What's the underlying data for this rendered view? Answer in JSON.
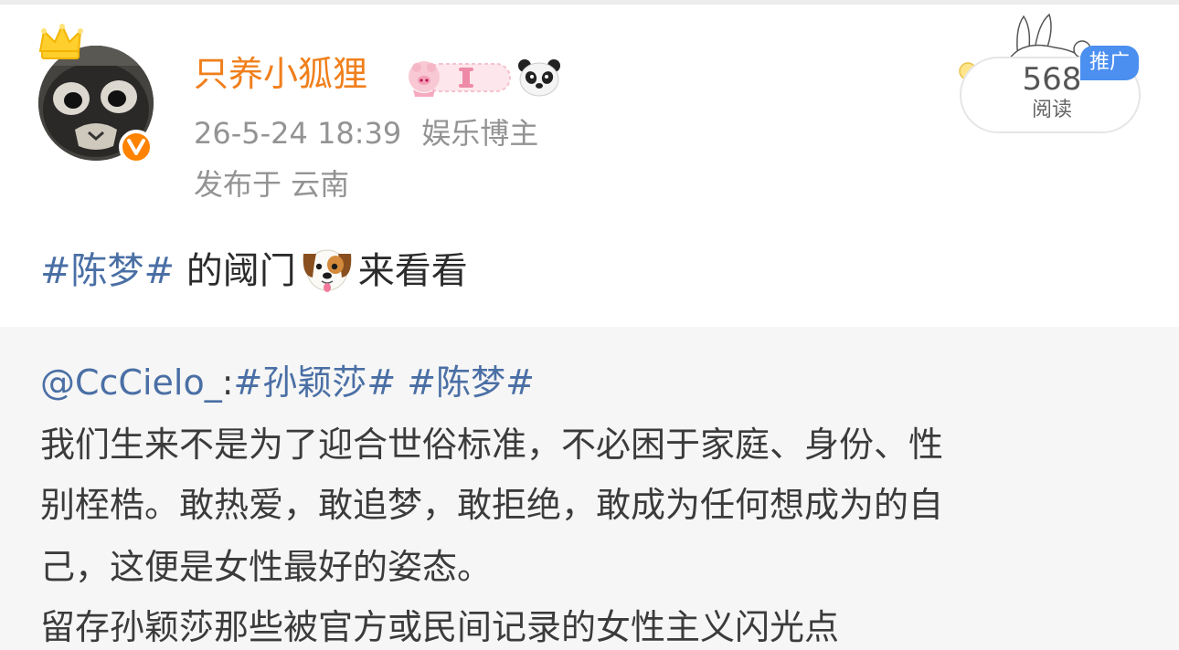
{
  "post": {
    "author": {
      "name": "只养小狐狸",
      "avatar_icon": "avatar-image",
      "verified_icon": "verified-v-icon",
      "crown_icon": "crown-icon",
      "badge_icon": "pig-bow-badge-icon",
      "panda_icon": "panda-icon"
    },
    "meta": {
      "timestamp": "26-5-24 18:39",
      "role": "娱乐博主",
      "location": "发布于 云南"
    },
    "stats": {
      "read_count": "568",
      "read_label": "阅读",
      "promo_label": "推广"
    },
    "content": {
      "hashtag": "#陈梦#",
      "text_before_emoji": " 的阈门",
      "emoji_icon": "dog-face-emoji",
      "text_after_emoji": "来看看"
    }
  },
  "repost": {
    "mention": "@CcCielo_",
    "colon": ":",
    "hashtags": [
      "#孙颖莎#",
      "#陈梦#"
    ],
    "lines": [
      "我们生来不是为了迎合世俗标准，不必困于家庭、身份、性",
      "别桎梏。敢热爱，敢追梦，敢拒绝，敢成为任何想成为的自",
      "己，这便是女性最好的姿态。",
      "留存孙颖莎那些被官方或民间记录的女性主义闪光点"
    ]
  },
  "colors": {
    "username": "#f07f1c",
    "meta_gray": "#939393",
    "hashtag_blue": "#4a6fa5",
    "promo_blue": "#4b8ff0",
    "repost_bg": "#f6f6f6",
    "verified_orange": "#ff8200"
  }
}
